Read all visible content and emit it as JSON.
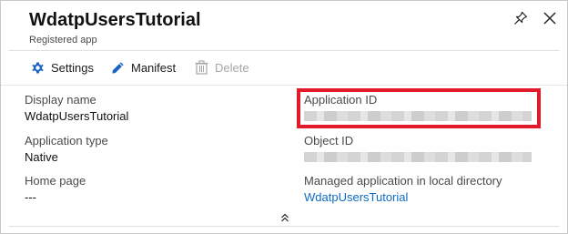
{
  "header": {
    "title": "WdatpUsersTutorial",
    "subtitle": "Registered app",
    "icons": {
      "pin": "pin-icon",
      "close": "close-icon"
    }
  },
  "toolbar": {
    "settings_label": "Settings",
    "manifest_label": "Manifest",
    "delete_label": "Delete",
    "icons": {
      "settings": "gear-icon",
      "manifest": "pencil-icon",
      "delete": "trash-icon"
    }
  },
  "essentials": {
    "display_name": {
      "label": "Display name",
      "value": "WdatpUsersTutorial"
    },
    "application_type": {
      "label": "Application type",
      "value": "Native"
    },
    "home_page": {
      "label": "Home page",
      "value": "---"
    },
    "application_id": {
      "label": "Application ID"
    },
    "object_id": {
      "label": "Object ID"
    },
    "managed_app": {
      "label": "Managed application in local directory",
      "value": "WdatpUsersTutorial"
    }
  },
  "colors": {
    "accent_blue": "#0b6cc5",
    "highlight_red": "#e11b2a",
    "disabled_gray": "#a6a6a6"
  },
  "expander_icon": "chevron-double-up-icon"
}
